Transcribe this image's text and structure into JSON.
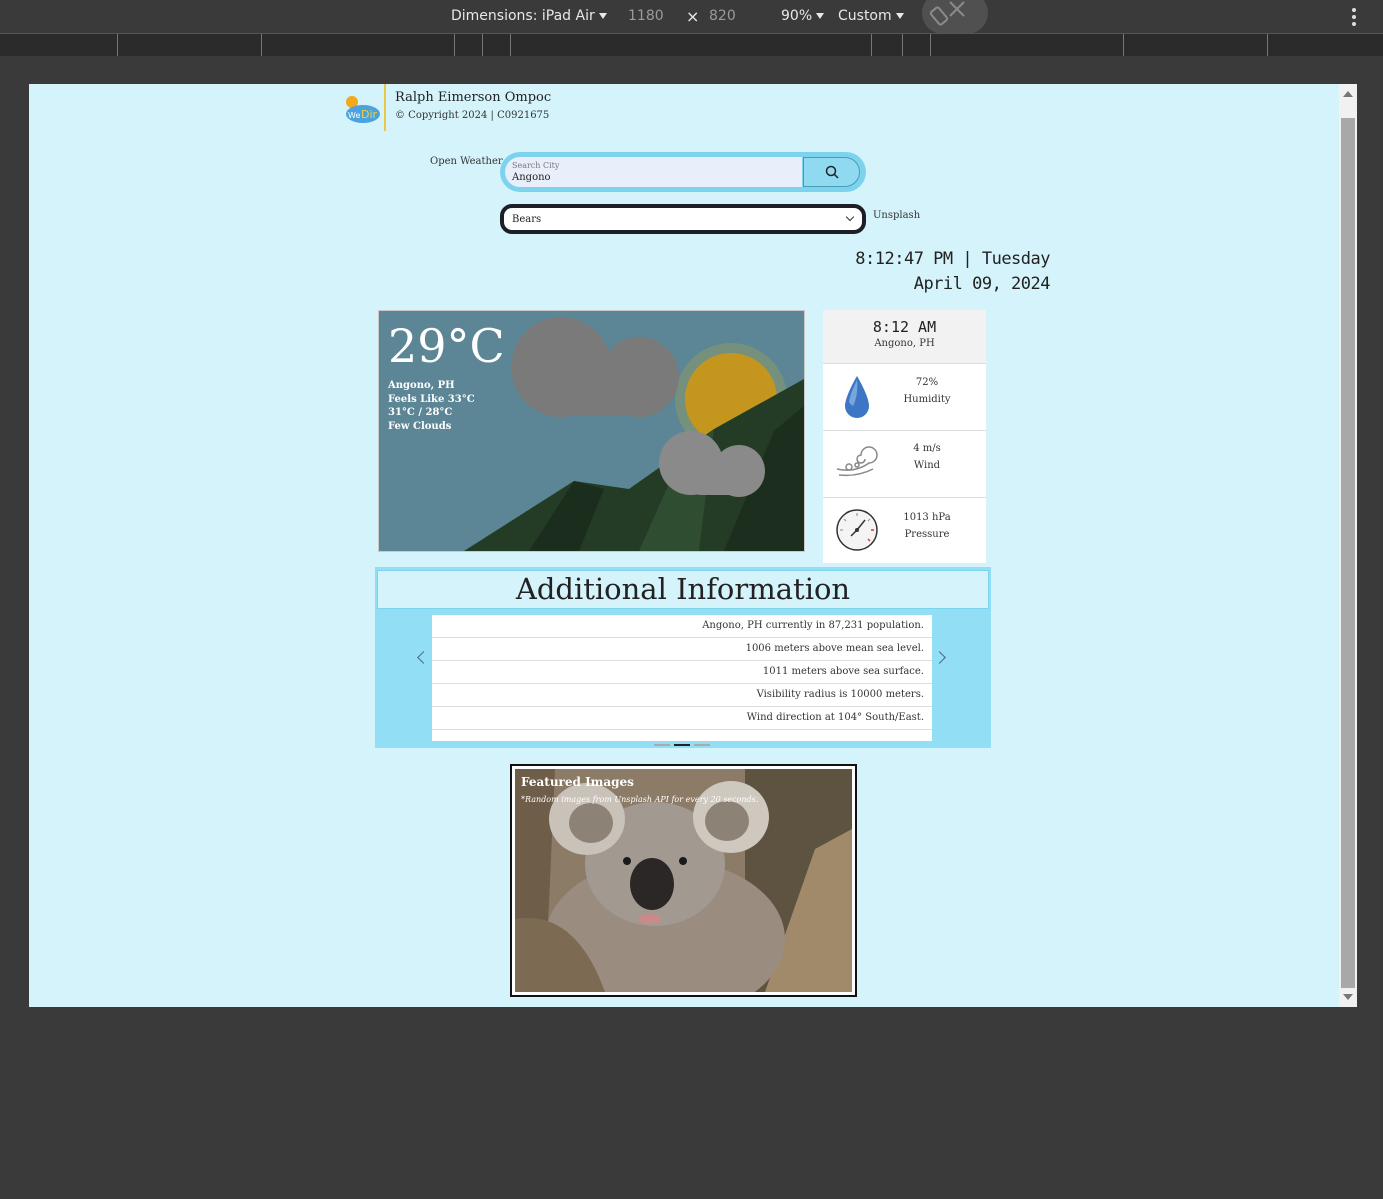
{
  "devtools": {
    "dimensions_label": "Dimensions: iPad Air",
    "width": "1180",
    "times": "×",
    "height": "820",
    "zoom": "90%",
    "throttle": "Custom",
    "icons": [
      "rotate-icon",
      "more-options-icon"
    ]
  },
  "header": {
    "author": "Ralph Eimerson Ompoc",
    "copyright": "© Copyright 2024 | C0921675",
    "logo_icon": "wedir-logo"
  },
  "search": {
    "label": "Open Weather",
    "placeholder": "Search City",
    "value": "Angono",
    "button_icon": "search-icon"
  },
  "image_select": {
    "selected": "Bears",
    "label": "Unsplash"
  },
  "clock": {
    "time_day": "8:12:47 PM | Tuesday",
    "date": "April 09, 2024"
  },
  "weather": {
    "temperature": "29°C",
    "location": "Angono, PH",
    "feels_like": "Feels Like 33°C",
    "high_low": "31°C / 28°C",
    "description": "Few Clouds"
  },
  "details": {
    "time": "8:12 AM",
    "location": "Angono, PH",
    "humidity_value": "72%",
    "humidity_label": "Humidity",
    "wind_value": "4 m/s",
    "wind_label": "Wind",
    "pressure_value": "1013 hPa",
    "pressure_label": "Pressure",
    "icons": [
      "humidity-drop-icon",
      "wind-icon",
      "pressure-gauge-icon"
    ]
  },
  "additional": {
    "title": "Additional Information",
    "items": [
      "Angono, PH currently in 87,231 population.",
      "1006 meters above mean sea level.",
      "1011 meters above sea surface.",
      "Visibility radius is 10000 meters.",
      "Wind direction at 104° South/East."
    ],
    "slide_count": 3,
    "active_slide": 2
  },
  "featured": {
    "title": "Featured Images",
    "subtitle": "*Random images from Unsplash API for every 20 seconds."
  },
  "colors": {
    "page_bg": "#d4f3fb",
    "accent": "#7dd3ee",
    "devtools_bg": "#3a3a3a"
  }
}
